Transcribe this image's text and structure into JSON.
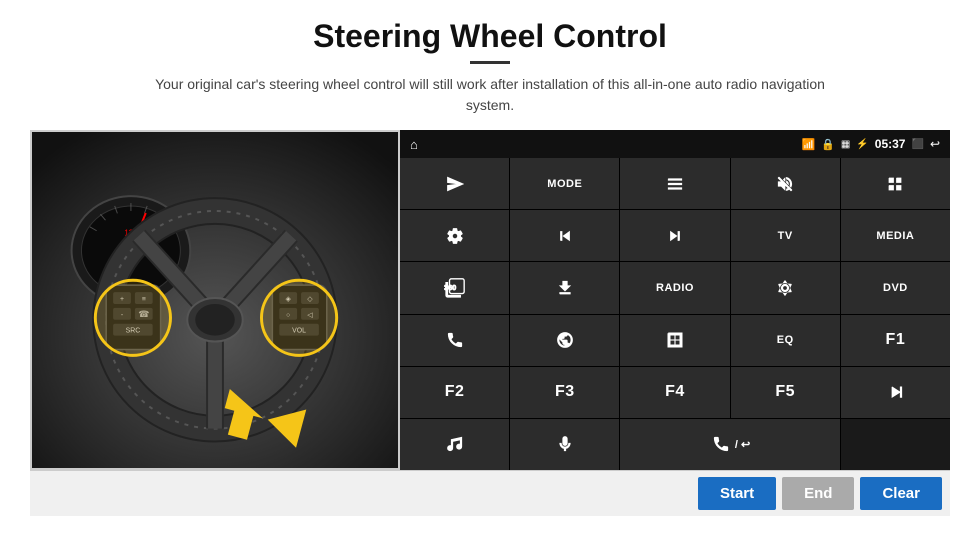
{
  "page": {
    "title": "Steering Wheel Control",
    "subtitle": "Your original car's steering wheel control will still work after installation of this all-in-one auto radio navigation system.",
    "divider": true
  },
  "statusBar": {
    "time": "05:37",
    "homeIcon": "home-icon",
    "wifiIcon": "wifi-icon",
    "lockIcon": "lock-icon",
    "sdIcon": "sd-icon",
    "bluetoothIcon": "bluetooth-icon",
    "screenIcon": "screen-icon",
    "backIcon": "back-icon"
  },
  "grid": {
    "rows": [
      [
        {
          "type": "icon",
          "icon": "send",
          "name": "send-btn"
        },
        {
          "type": "text",
          "label": "MODE",
          "name": "mode-btn"
        },
        {
          "type": "icon",
          "icon": "list",
          "name": "list-btn"
        },
        {
          "type": "icon",
          "icon": "mute",
          "name": "mute-btn"
        },
        {
          "type": "icon",
          "icon": "apps",
          "name": "apps-btn"
        }
      ],
      [
        {
          "type": "icon",
          "icon": "settings",
          "name": "settings-btn"
        },
        {
          "type": "icon",
          "icon": "rewind",
          "name": "rewind-btn"
        },
        {
          "type": "icon",
          "icon": "forward",
          "name": "forward-btn"
        },
        {
          "type": "text",
          "label": "TV",
          "name": "tv-btn"
        },
        {
          "type": "text",
          "label": "MEDIA",
          "name": "media-btn"
        }
      ],
      [
        {
          "type": "icon",
          "icon": "360cam",
          "name": "cam360-btn"
        },
        {
          "type": "icon",
          "icon": "eject",
          "name": "eject-btn"
        },
        {
          "type": "text",
          "label": "RADIO",
          "name": "radio-btn"
        },
        {
          "type": "icon",
          "icon": "brightness",
          "name": "brightness-btn"
        },
        {
          "type": "text",
          "label": "DVD",
          "name": "dvd-btn"
        }
      ],
      [
        {
          "type": "icon",
          "icon": "phone",
          "name": "phone-btn"
        },
        {
          "type": "icon",
          "icon": "globe",
          "name": "globe-btn"
        },
        {
          "type": "icon",
          "icon": "window",
          "name": "window-btn"
        },
        {
          "type": "text",
          "label": "EQ",
          "name": "eq-btn"
        },
        {
          "type": "text",
          "label": "F1",
          "name": "f1-btn"
        }
      ],
      [
        {
          "type": "text",
          "label": "F2",
          "name": "f2-btn"
        },
        {
          "type": "text",
          "label": "F3",
          "name": "f3-btn"
        },
        {
          "type": "text",
          "label": "F4",
          "name": "f4-btn"
        },
        {
          "type": "text",
          "label": "F5",
          "name": "f5-btn"
        },
        {
          "type": "icon",
          "icon": "playpause",
          "name": "playpause-btn"
        }
      ],
      [
        {
          "type": "icon",
          "icon": "music",
          "name": "music-btn"
        },
        {
          "type": "icon",
          "icon": "mic",
          "name": "mic-btn"
        },
        {
          "type": "icon",
          "icon": "phonecall",
          "name": "phonecall-btn"
        },
        {
          "type": "empty",
          "name": "empty1"
        },
        {
          "type": "empty",
          "name": "empty2"
        }
      ]
    ]
  },
  "bottomBar": {
    "startLabel": "Start",
    "endLabel": "End",
    "clearLabel": "Clear"
  }
}
